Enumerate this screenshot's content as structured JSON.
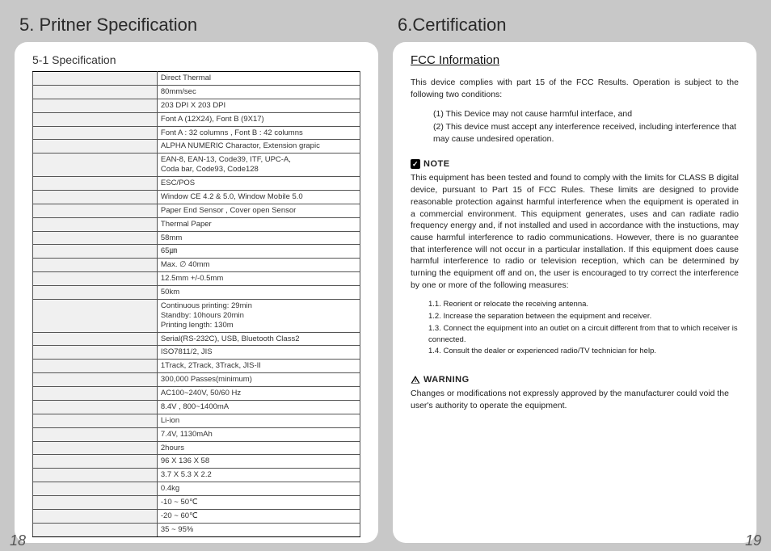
{
  "left": {
    "section_number": "5.",
    "section_title": "Pritner Specification",
    "sub_title": "5-1 Specification",
    "page_number": "18",
    "spec_rows": [
      "Direct Thermal",
      "80mm/sec",
      "203 DPI X 203 DPI",
      "Font A (12X24), Font B (9X17)",
      "Font A : 32 columns , Font B : 42 columns",
      "ALPHA NUMERIC Charactor, Extension grapic",
      "EAN-8, EAN-13, Code39, ITF, UPC-A,\nCoda bar, Code93, Code128",
      "ESC/POS",
      "Window CE 4.2 & 5.0, Window Mobile 5.0",
      "Paper End Sensor , Cover open Sensor",
      "Thermal Paper",
      "58mm",
      "65㎛",
      "Max. ∅ 40mm",
      "12.5mm +/-0.5mm",
      "50km",
      "Continuous printing: 29min\nStandby: 10hours 20min\nPrinting length: 130m",
      "Serial(RS-232C), USB, Bluetooth Class2",
      "ISO7811/2, JIS",
      "1Track, 2Track, 3Track, JIS-II",
      "300,000 Passes(minimum)",
      "AC100~240V, 50/60 Hz",
      "8.4V , 800~1400mA",
      "Li-ion",
      "7.4V, 1130mAh",
      "2hours",
      "96 X 136 X 58",
      "3.7 X 5.3 X 2.2",
      "0.4kg",
      "-10 ~ 50℃",
      "-20 ~ 60℃",
      "35 ~ 95%"
    ]
  },
  "right": {
    "section_number": "6.",
    "section_title": "Certification",
    "heading": "FCC Information",
    "page_number": "19",
    "intro": "This device complies with part 15 of the FCC Results. Operation is subject to the following two conditions:",
    "conditions": [
      "(1) This Device may not cause harmful interface, and",
      "(2) This device must accept any interference received, including interference that may cause undesired operation."
    ],
    "note_label": "NOTE",
    "note_body": "This equipment has been tested and found to comply with the limits for CLASS B digital device, pursuant to Part 15 of FCC Rules. These limits are designed to provide reasonable protection against harmful interference when the equipment is operated in a commercial environment. This equipment generates, uses and can radiate radio frequency energy and, if not installed and used in accordance with the instuctions, may cause harmful interference to radio communications. However, there is no guarantee that interference will not occur in a particular installation. If this equipment does cause harmful interference to radio or television reception, which can be determined by turning the equipment off and on, the user is encouraged to try correct the interference by one or more of the following measures:",
    "measures": [
      "1.1. Reorient or relocate the receiving antenna.",
      "1.2. Increase the separation between the equipment and receiver.",
      "1.3. Connect the equipment into an outlet on a circuit different from that to which receiver is connected.",
      "1.4. Consult the dealer or experienced radio/TV technician for help."
    ],
    "warning_label": "WARNING",
    "warning_body": "Changes or modifications not expressly approved by the manufacturer could void the user's authority to operate the equipment."
  }
}
